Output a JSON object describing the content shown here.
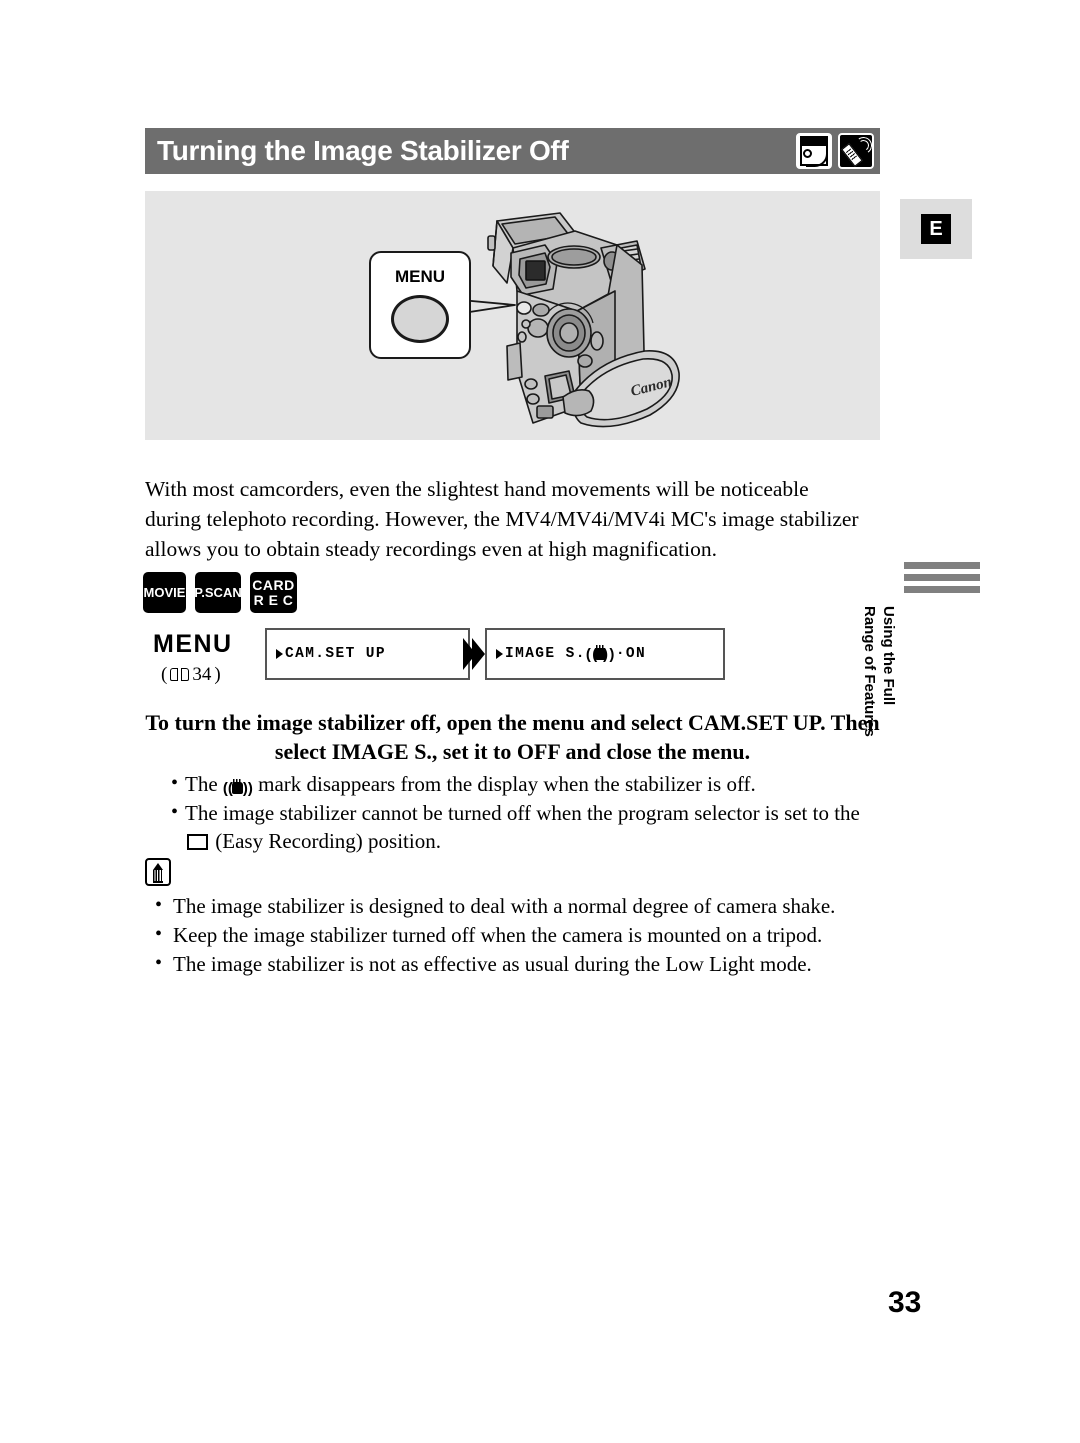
{
  "header": {
    "title": "Turning the Image Stabilizer Off",
    "icons": [
      "cassette-tape-icon",
      "remote-control-icon"
    ]
  },
  "side_tab_letter": "E",
  "illustration": {
    "callout_label": "MENU",
    "brand": "Canon"
  },
  "intro": "With most camcorders, even the slightest hand movements will be noticeable during telephoto recording. However, the MV4/MV4i/MV4i MC's image stabilizer allows you to obtain steady recordings even at high magnification.",
  "badges": [
    {
      "line1": "MOVIE"
    },
    {
      "line1": "P.SCAN"
    },
    {
      "line1": "CARD",
      "line2": "R E C"
    }
  ],
  "menu_flow": {
    "label": "MENU",
    "reference_open": "(",
    "reference_page": "34",
    "reference_close": ")",
    "step1": "CAM.SET UP",
    "step2_prefix": "IMAGE S.",
    "step2_suffix": "·ON"
  },
  "instruction": {
    "heading": "To turn the image stabilizer off, open the menu and select CAM.SET UP. Then select IMAGE S., set it to OFF and close the menu.",
    "bullets": [
      {
        "pre": "The ",
        "post": " mark disappears from the display when the stabilizer is off.",
        "icon": "stabilizer-hand-icon"
      },
      {
        "pre": "The image stabilizer cannot be turned off when the program selector is set to the ",
        "post": " (Easy Recording) position.",
        "icon": "easy-recording-icon"
      }
    ]
  },
  "notes": {
    "icon": "note-memo-icon",
    "bullets": [
      "The image stabilizer is designed to deal with a normal degree of camera shake.",
      "Keep the image stabilizer turned off when the camera is mounted on a tripod.",
      "The image stabilizer is not as effective as usual during the Low Light mode."
    ]
  },
  "side_tab": {
    "line1": "Using the Full",
    "line2": "Range of Features"
  },
  "page_number": "33",
  "colors": {
    "header_bar": "#6e6e6e",
    "illustration_panel": "#e5e5e5",
    "side_tab_bg": "#dddddd",
    "side_bars": "#808080"
  }
}
